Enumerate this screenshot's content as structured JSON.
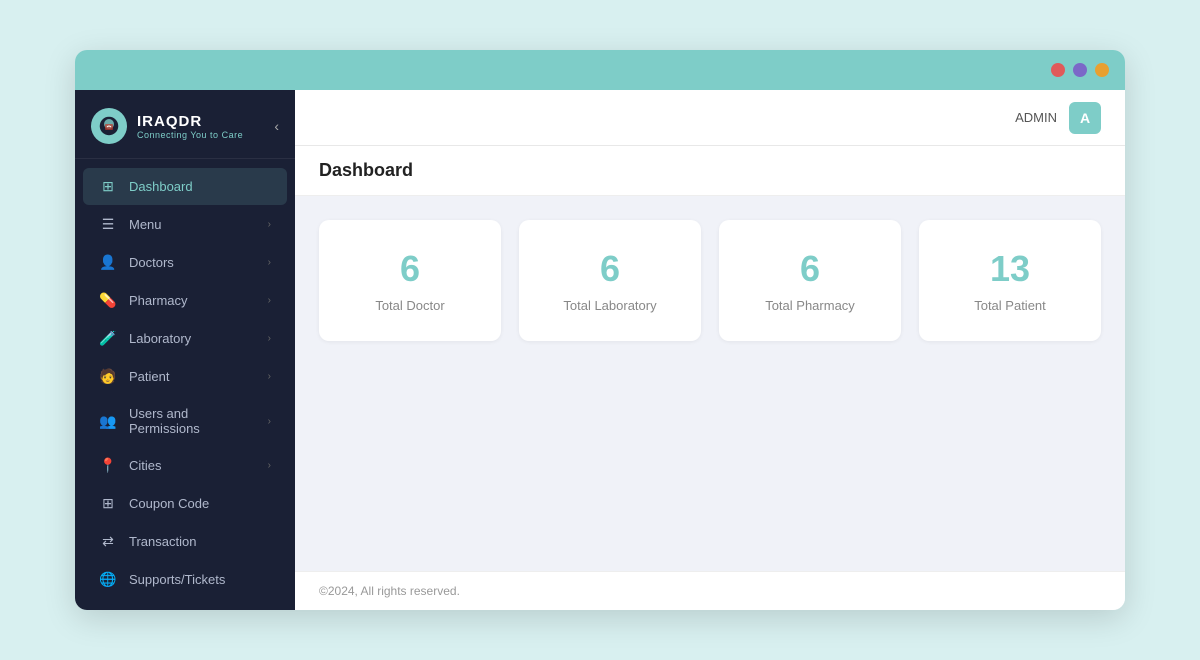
{
  "window": {
    "title_bar": {
      "traffic_lights": [
        "red",
        "purple",
        "orange"
      ]
    }
  },
  "sidebar": {
    "logo": {
      "title": "IRAQDR",
      "subtitle": "Connecting You to Care",
      "icon": "🏥"
    },
    "nav_items": [
      {
        "id": "dashboard",
        "label": "Dashboard",
        "icon": "⊞",
        "active": true,
        "has_chevron": false
      },
      {
        "id": "menu",
        "label": "Menu",
        "icon": "☰",
        "active": false,
        "has_chevron": true
      },
      {
        "id": "doctors",
        "label": "Doctors",
        "icon": "👤",
        "active": false,
        "has_chevron": true
      },
      {
        "id": "pharmacy",
        "label": "Pharmacy",
        "icon": "💊",
        "active": false,
        "has_chevron": true
      },
      {
        "id": "laboratory",
        "label": "Laboratory",
        "icon": "🧪",
        "active": false,
        "has_chevron": true
      },
      {
        "id": "patient",
        "label": "Patient",
        "icon": "🧑",
        "active": false,
        "has_chevron": true
      },
      {
        "id": "users-permissions",
        "label": "Users and Permissions",
        "icon": "👥",
        "active": false,
        "has_chevron": true
      },
      {
        "id": "cities",
        "label": "Cities",
        "icon": "📍",
        "active": false,
        "has_chevron": true
      },
      {
        "id": "coupon-code",
        "label": "Coupon Code",
        "icon": "⊞",
        "active": false,
        "has_chevron": false
      },
      {
        "id": "transaction",
        "label": "Transaction",
        "icon": "⇄",
        "active": false,
        "has_chevron": false
      },
      {
        "id": "supports-tickets",
        "label": "Supports/Tickets",
        "icon": "🌐",
        "active": false,
        "has_chevron": false
      }
    ]
  },
  "topbar": {
    "admin_label": "ADMIN",
    "admin_avatar": "A"
  },
  "main": {
    "page_title": "Dashboard",
    "stats": [
      {
        "id": "total-doctor",
        "number": "6",
        "label": "Total Doctor"
      },
      {
        "id": "total-laboratory",
        "number": "6",
        "label": "Total Laboratory"
      },
      {
        "id": "total-pharmacy",
        "number": "6",
        "label": "Total Pharmacy"
      },
      {
        "id": "total-patient",
        "number": "13",
        "label": "Total Patient"
      }
    ],
    "footer": "©2024, All rights reserved."
  }
}
